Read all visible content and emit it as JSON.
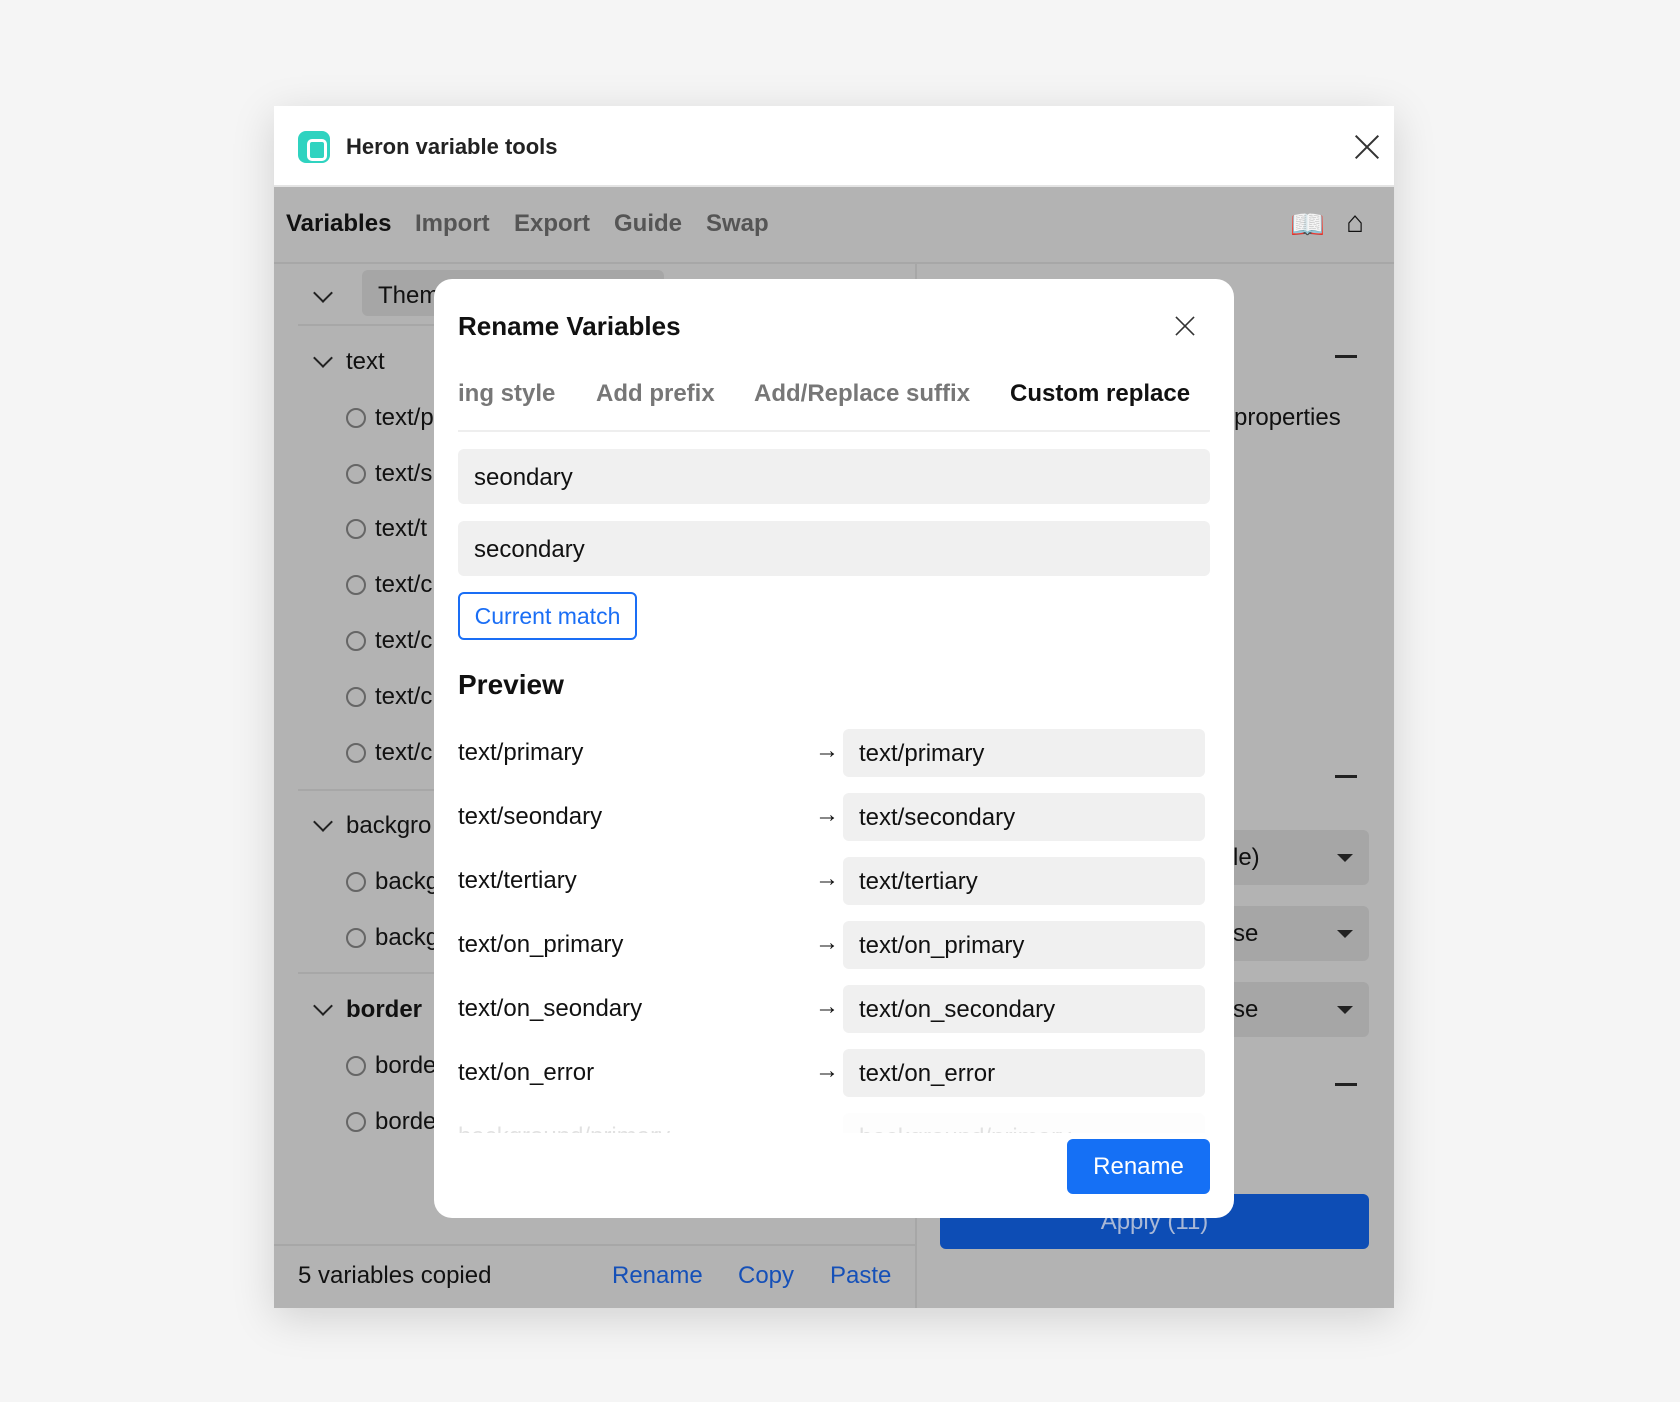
{
  "app": {
    "title": "Heron variable tools"
  },
  "nav": {
    "tabs": [
      "Variables",
      "Import",
      "Export",
      "Guide",
      "Swap"
    ],
    "active": "Variables"
  },
  "left": {
    "theme_select": "Them",
    "groups": [
      {
        "label": "text",
        "items": [
          "text/p",
          "text/s",
          "text/t",
          "text/c",
          "text/c",
          "text/c",
          "text/c"
        ]
      },
      {
        "label": "backgro",
        "items": [
          "backg",
          "backg"
        ]
      },
      {
        "label": "border",
        "items": [
          "borde",
          "borde"
        ]
      }
    ]
  },
  "right": {
    "properties_label": "properties",
    "dropdowns": [
      "le)",
      "se",
      "se"
    ],
    "apply_label": "Apply (11)"
  },
  "footer": {
    "status": "5 variables copied",
    "rename": "Rename",
    "copy": "Copy",
    "paste": "Paste"
  },
  "modal": {
    "title": "Rename Variables",
    "tabs": [
      "ing style",
      "Add prefix",
      "Add/Replace suffix",
      "Custom replace"
    ],
    "active_tab": "Custom replace",
    "find_value": "seondary",
    "replace_value": "secondary",
    "current_match_label": "Current match",
    "preview_heading": "Preview",
    "arrow": "→",
    "preview": [
      {
        "from": "text/primary",
        "to": "text/primary"
      },
      {
        "from": "text/seondary",
        "to": "text/secondary"
      },
      {
        "from": "text/tertiary",
        "to": "text/tertiary"
      },
      {
        "from": "text/on_primary",
        "to": "text/on_primary"
      },
      {
        "from": "text/on_seondary",
        "to": "text/on_secondary"
      },
      {
        "from": "text/on_error",
        "to": "text/on_error"
      },
      {
        "from": "background/primary",
        "to": "background/primary"
      }
    ],
    "rename_label": "Rename"
  },
  "colors": {
    "accent": "#1570f5",
    "teal": "#2fd3c0",
    "overlay": "#b3b3b3"
  }
}
